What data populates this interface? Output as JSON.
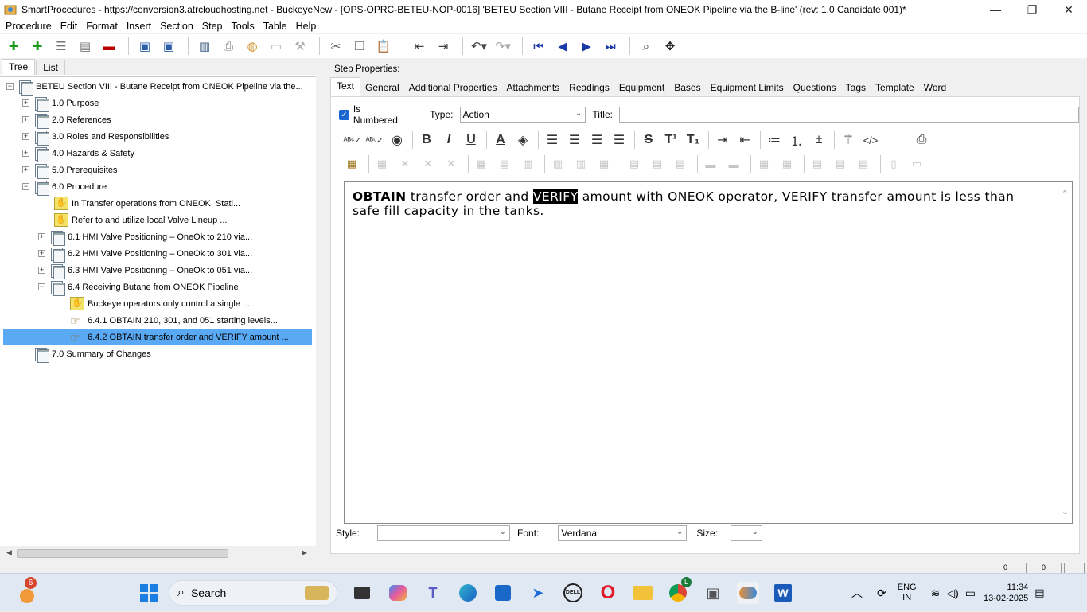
{
  "window": {
    "title": "SmartProcedures - https://conversion3.atrcloudhosting.net - BuckeyeNew - [OPS-OPRC-BETEU-NOP-0016] 'BETEU Section VIII - Butane Receipt from ONEOK Pipeline via the B-line' (rev: 1.0 Candidate 001)*",
    "minimize": "—",
    "restore": "❐",
    "close": "✕"
  },
  "menu": [
    "Procedure",
    "Edit",
    "Format",
    "Insert",
    "Section",
    "Step",
    "Tools",
    "Table",
    "Help"
  ],
  "left_tabs": [
    "Tree",
    "List"
  ],
  "tree": [
    {
      "label": "BETEU Section VIII - Butane Receipt from ONEOK Pipeline via the...",
      "expander": "−",
      "icon": "doc"
    },
    {
      "label": "1.0 Purpose",
      "expander": "+",
      "icon": "doc"
    },
    {
      "label": "2.0 References",
      "expander": "+",
      "icon": "doc"
    },
    {
      "label": "3.0 Roles and Responsibilities",
      "expander": "+",
      "icon": "doc"
    },
    {
      "label": "4.0 Hazards & Safety",
      "expander": "+",
      "icon": "doc"
    },
    {
      "label": "5.0 Prerequisites",
      "expander": "+",
      "icon": "doc"
    },
    {
      "label": "6.0 Procedure",
      "expander": "−",
      "icon": "doc"
    },
    {
      "label": "In Transfer operations from ONEOK, Stati...",
      "expander": "",
      "icon": "warning"
    },
    {
      "label": "Refer to and utilize local Valve Lineup ...",
      "expander": "",
      "icon": "warning"
    },
    {
      "label": "6.1 HMI Valve Positioning – OneOk to 210 via...",
      "expander": "+",
      "icon": "doc"
    },
    {
      "label": "6.2 HMI Valve Positioning – OneOk to 301 via...",
      "expander": "+",
      "icon": "doc"
    },
    {
      "label": "6.3 HMI Valve Positioning – OneOk to 051 via...",
      "expander": "+",
      "icon": "doc"
    },
    {
      "label": "6.4 Receiving Butane from ONEOK Pipeline",
      "expander": "−",
      "icon": "doc"
    },
    {
      "label": "Buckeye operators only control a single ...",
      "expander": "",
      "icon": "warning"
    },
    {
      "label": "6.4.1 OBTAIN 210, 301, and 051 starting levels...",
      "expander": "",
      "icon": "action"
    },
    {
      "label": "6.4.2 OBTAIN transfer order and VERIFY amount ...",
      "expander": "",
      "icon": "action",
      "selected": true
    },
    {
      "label": "7.0 Summary of Changes",
      "expander": "",
      "icon": "doc"
    }
  ],
  "step_properties": {
    "label": "Step Properties:",
    "tabs": [
      "Text",
      "General",
      "Additional Properties",
      "Attachments",
      "Readings",
      "Equipment",
      "Bases",
      "Equipment Limits",
      "Questions",
      "Tags",
      "Template",
      "Word"
    ],
    "is_numbered_label": "Is Numbered",
    "is_numbered_checked": true,
    "type_label": "Type:",
    "type_value": "Action",
    "title_label": "Title:",
    "title_value": ""
  },
  "editor": {
    "word1": "OBTAIN",
    "text1": " transfer order and ",
    "highlight": "VERIFY",
    "text2": " amount with ONEOK operator, VERIFY transfer amount is less than safe fill capacity in the tanks."
  },
  "bottom": {
    "style_label": "Style:",
    "style_value": "",
    "font_label": "Font:",
    "font_value": "Verdana",
    "size_label": "Size:",
    "size_value": ""
  },
  "status": [
    "0",
    "0"
  ],
  "taskbar": {
    "weather_badge": "6",
    "search_label": "Search",
    "chrome_badge": "L",
    "lang_top": "ENG",
    "lang_bottom": "IN",
    "time": "11:34",
    "date": "13-02-2025"
  }
}
